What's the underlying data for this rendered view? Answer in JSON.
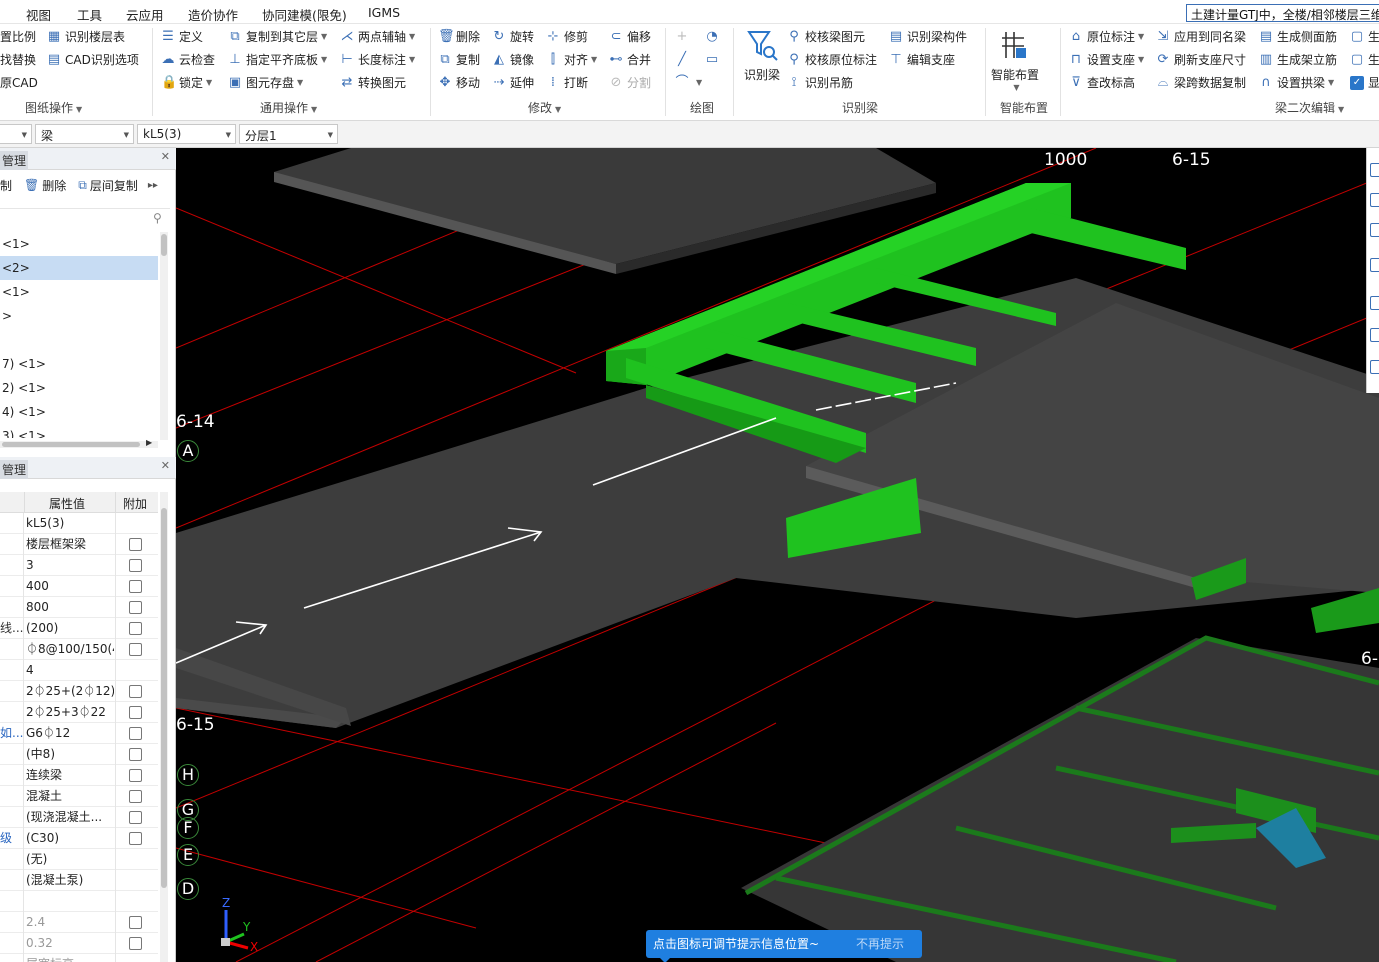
{
  "menubar": {
    "items": [
      "视图",
      "工具",
      "云应用",
      "造价协作",
      "协同建模(限免)",
      "IGMS"
    ],
    "notice": "土建计量GTJ中，全楼/相邻楼层三维"
  },
  "ribbon": {
    "drawing_ops": {
      "items": [
        "置比例",
        "找替换",
        "原CAD"
      ],
      "extra": [
        "识别楼层表",
        "CAD识别选项"
      ],
      "label": "图纸操作"
    },
    "general_ops": {
      "col1": [
        "定义",
        "云检查",
        "锁定"
      ],
      "col2": [
        "复制到其它层",
        "指定平齐底板",
        "图元存盘"
      ],
      "col3": [
        "两点辅轴",
        "长度标注",
        "转换图元"
      ],
      "label": "通用操作"
    },
    "modify": {
      "col1": [
        "删除",
        "复制",
        "移动"
      ],
      "col2": [
        "旋转",
        "镜像",
        "延伸"
      ],
      "col3": [
        "修剪",
        "对齐",
        "打断"
      ],
      "col4": [
        "偏移",
        "合并",
        "分割"
      ],
      "label": "修改"
    },
    "draw": {
      "label": "绘图"
    },
    "recognize_beam": {
      "big": "识别梁",
      "col2": [
        "校核梁图元",
        "校核原位标注",
        "识别吊筋"
      ],
      "col3": [
        "识别梁构件",
        "编辑支座"
      ],
      "label": "识别梁"
    },
    "smart_layout": {
      "big": "智能布置",
      "label": "智能布置"
    },
    "beam_edit": {
      "col1": [
        "原位标注",
        "设置支座",
        "查改标高"
      ],
      "col2": [
        "应用到同名梁",
        "刷新支座尺寸",
        "梁跨数据复制"
      ],
      "col3": [
        "生成侧面筋",
        "生成架立筋",
        "设置拱梁"
      ],
      "col4": [
        "生",
        "生",
        "显"
      ],
      "label": "梁二次编辑"
    }
  },
  "toolbar2": {
    "combos": [
      "",
      "梁",
      "kL5(3)",
      "分层1"
    ]
  },
  "left_panel": {
    "tree_header": "管理",
    "tree_tools": [
      "制",
      "删除",
      "层间复制"
    ],
    "tree_rows": [
      "<1>",
      "<2>",
      "<1>",
      ">",
      "",
      "7) <1>",
      "2) <1>",
      "4) <1>",
      "3) <1>"
    ],
    "prop_header": "管理",
    "prop_columns": {
      "value": "属性值",
      "extra": "附加"
    },
    "props": [
      {
        "name": "",
        "value": "kL5(3)",
        "check": false
      },
      {
        "name": "",
        "value": "楼层框架梁",
        "check": true
      },
      {
        "name": "",
        "value": "3",
        "check": true
      },
      {
        "name": "",
        "value": "400",
        "check": true
      },
      {
        "name": "",
        "value": "800",
        "check": true
      },
      {
        "name": "线...",
        "value": "(200)",
        "check": true
      },
      {
        "name": "",
        "value": "⏀8@100/150(4",
        "check": true
      },
      {
        "name": "",
        "value": "4",
        "check": false
      },
      {
        "name": "",
        "value": "2⏀25+(2⏀12)",
        "check": true
      },
      {
        "name": "",
        "value": "2⏀25+3⏀22",
        "check": true
      },
      {
        "name": "如...",
        "value": "G6⏀12",
        "check": true
      },
      {
        "name": "",
        "value": "(中8)",
        "check": true
      },
      {
        "name": "",
        "value": "连续梁",
        "check": true
      },
      {
        "name": "",
        "value": "混凝土",
        "check": true
      },
      {
        "name": "",
        "value": "(现浇混凝土...",
        "check": true
      },
      {
        "name": "级",
        "value": "(C30)",
        "check": true
      },
      {
        "name": "",
        "value": "(无)",
        "check": false
      },
      {
        "name": "",
        "value": "(混凝土泵)",
        "check": false
      },
      {
        "name": "",
        "value": "",
        "check": false
      },
      {
        "name": "",
        "value": "2.4",
        "check": true,
        "dim": true
      },
      {
        "name": "",
        "value": "0.32",
        "check": true,
        "dim": true
      },
      {
        "name": "",
        "value": "属宽标高",
        "check": false,
        "dim": true
      }
    ]
  },
  "viewport": {
    "axis_labels": [
      "1000",
      "6-15",
      "6-14",
      "A",
      "6-15",
      "H",
      "G",
      "F",
      "E",
      "D",
      "6-"
    ],
    "coord_axes": [
      "Z",
      "Y",
      "X"
    ],
    "tip": {
      "text": "点击图标可调节提示信息位置~",
      "dismiss": "不再提示"
    },
    "colors": {
      "beam": "#1fc21f",
      "slab": "#3d3d3d",
      "grid": "#d40000",
      "background": "#000000"
    }
  }
}
